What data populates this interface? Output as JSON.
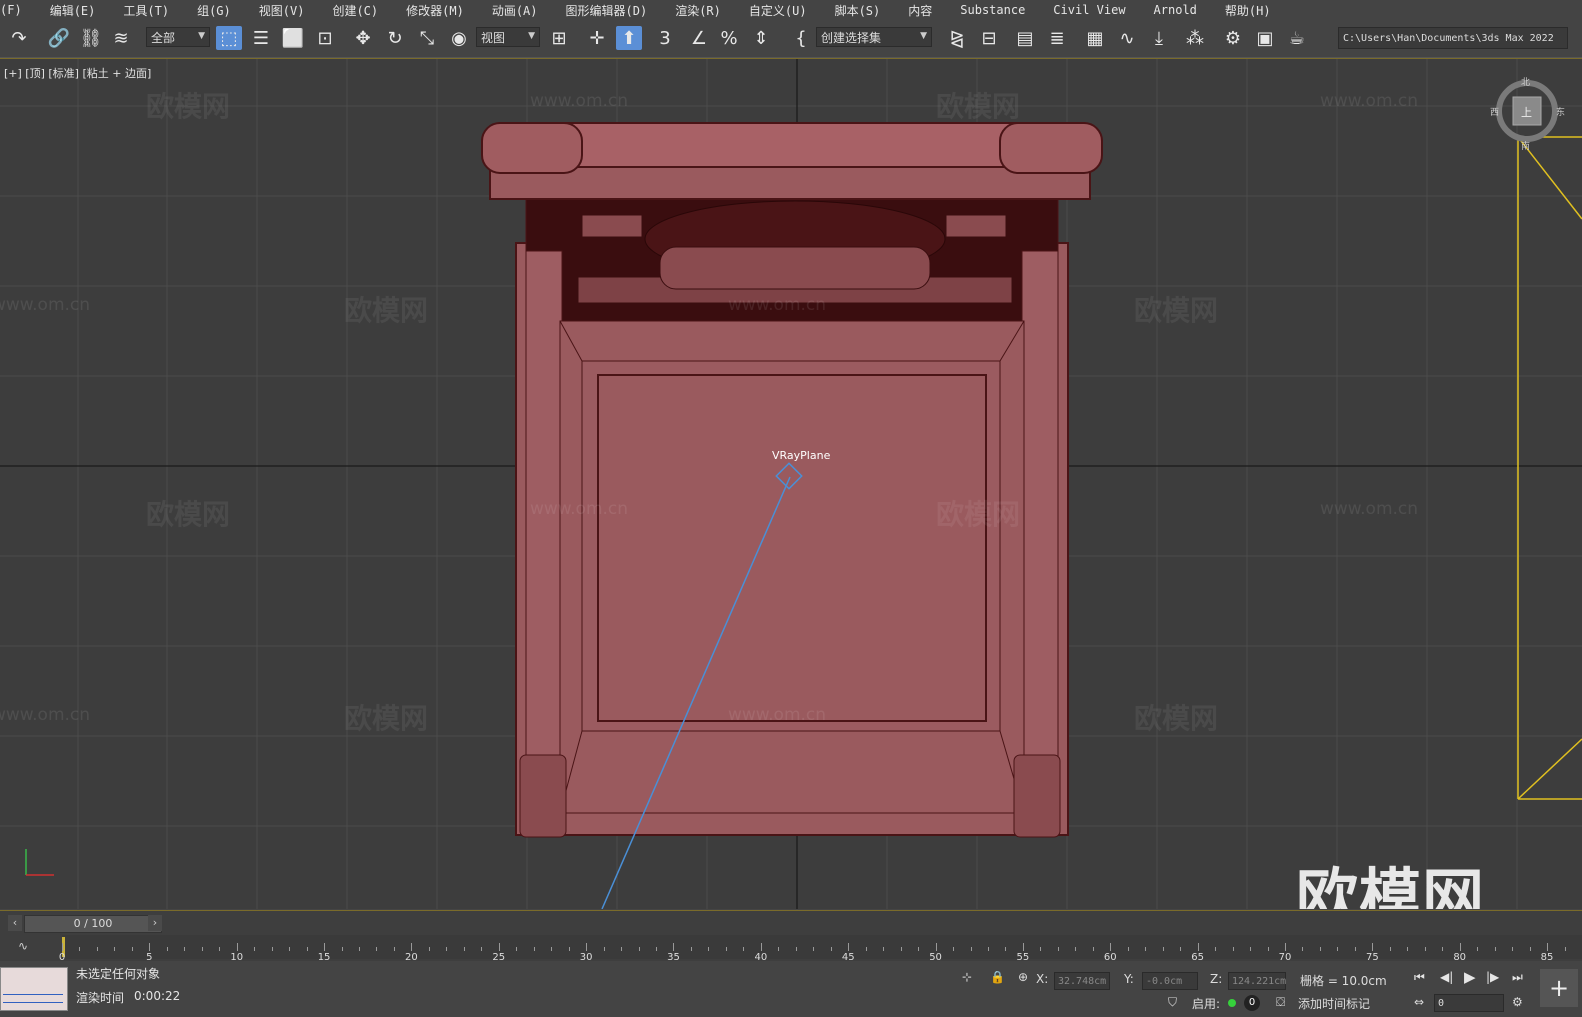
{
  "menu": [
    "(F)",
    "编辑(E)",
    "工具(T)",
    "组(G)",
    "视图(V)",
    "创建(C)",
    "修改器(M)",
    "动画(A)",
    "图形编辑器(D)",
    "渲染(R)",
    "自定义(U)",
    "脚本(S)",
    "内容",
    "Substance",
    "Civil View",
    "Arnold",
    "帮助(H)"
  ],
  "toolbar": {
    "filter_dropdown": "全部",
    "refcoord_dropdown": "视图",
    "selset_dropdown": "创建选择集",
    "project_path": "C:\\Users\\Han\\Documents\\3ds Max 2022"
  },
  "viewport": {
    "label": "[+] [顶] [标准] [粘土 + 边面]",
    "object_label": "VRayPlane",
    "watermark_cn": "欧模网",
    "watermark_url": "www.om.cn",
    "brand_watermark": "欧模网",
    "viewcube": {
      "north": "北",
      "west": "西",
      "east": "东",
      "south": "南",
      "face": "上"
    }
  },
  "timeline": {
    "slider_text": "0 / 100",
    "ticks": [
      "0",
      "5",
      "10",
      "15",
      "20",
      "25",
      "30",
      "35",
      "40",
      "45",
      "50",
      "55",
      "60",
      "65",
      "70",
      "75",
      "80",
      "85"
    ]
  },
  "status": {
    "selection_text": "未选定任何对象",
    "render_time_label": "渲染时间",
    "render_time_value": "0:00:22",
    "x_label": "X:",
    "x_value": "32.748cm",
    "y_label": "Y:",
    "y_value": "-0.0cm",
    "z_label": "Z:",
    "z_value": "124.221cm",
    "grid_text": "栅格 = 10.0cm",
    "enable_label": "启用:",
    "enable_count": "0",
    "add_time_tag": "添加时间标记",
    "frame_value": "0"
  },
  "colors": {
    "furniture_fill": "#9a5a5e",
    "furniture_line": "#4a1416",
    "vray_line": "#4a8fd6",
    "camera_frame": "#e0c020",
    "ui_bg": "#444444",
    "viewport_bg": "#3d3d3d",
    "select_blue": "#5b8fd6"
  }
}
